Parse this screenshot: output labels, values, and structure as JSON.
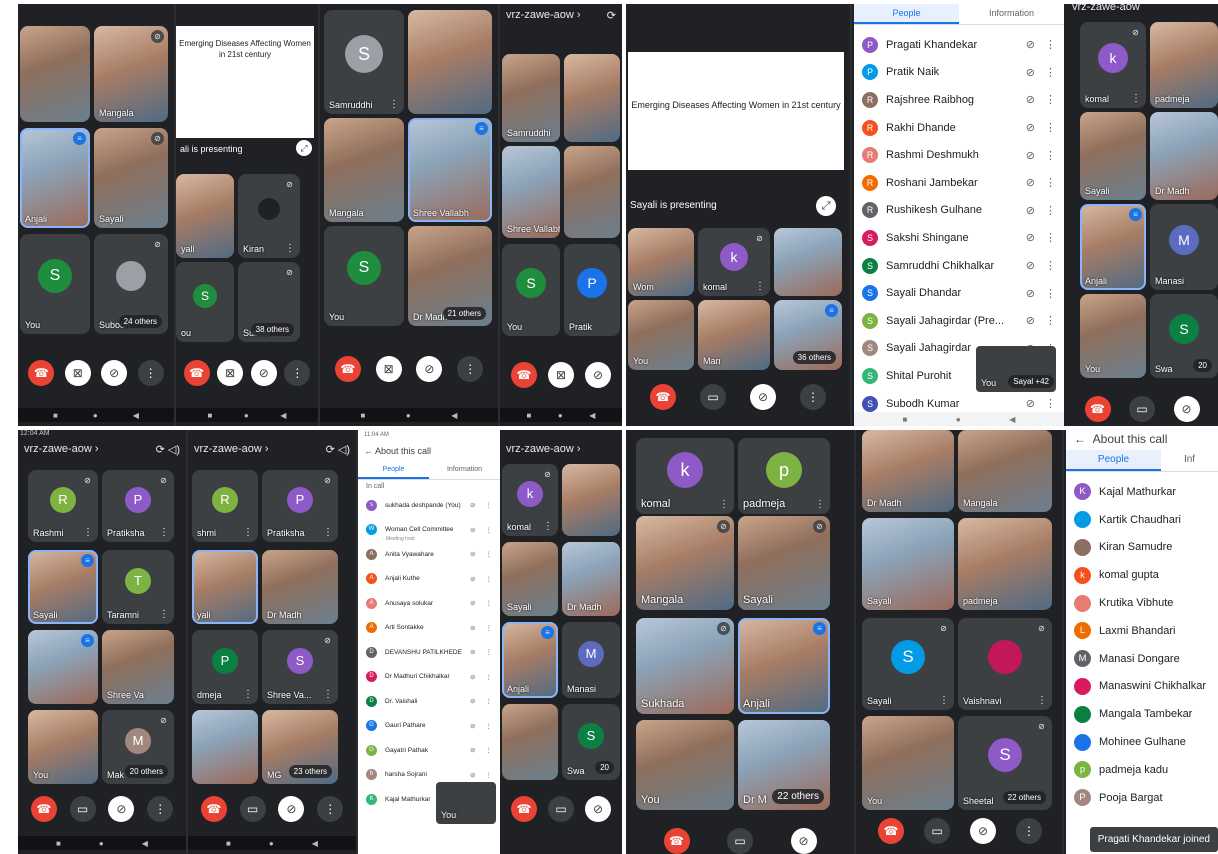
{
  "colors": {
    "end_call": "#ea4335",
    "accent": "#1a73e8",
    "tile_bg": "#3c4043"
  },
  "q1": {
    "s1": {
      "t1": "",
      "t2": "Mangala",
      "t3": "Anjali",
      "t4": "Sayali",
      "t5_avatar": "S",
      "t5": "You",
      "t6": "Subodh",
      "others": "24 others"
    },
    "s2": {
      "slide_title": "Emerging Diseases Affecting Women in 21st century",
      "presenting": "ali is presenting",
      "t1": "yali",
      "t2": "Kiran",
      "t3_avatar": "S",
      "t3": "ou",
      "t4": "Subod",
      "others": "38 others"
    },
    "s3": {
      "t1_avatar": "S",
      "t1": "Samruddhi",
      "t2": "",
      "t3": "Mangala",
      "t4": "Shree Vallabh",
      "t5_avatar": "S",
      "t5": "You",
      "t6": "Dr Madh",
      "others": "21 others"
    },
    "s4": {
      "hdr": "vrz-zawe-aow ›",
      "t1": "Samruddhi",
      "t2": "",
      "t3": "Shree Vallabh",
      "t4": "",
      "t5_avatar": "S",
      "t5": "You",
      "t6_avatar": "P",
      "t6": "Pratik"
    }
  },
  "q2": {
    "slide_title": "Emerging Diseases Affecting Women in 21st century",
    "presenting": "Sayali is presenting",
    "t1": "Wom",
    "t2_avatar": "k",
    "t2": "komal",
    "t3": "",
    "t4": "You",
    "t5": "Man",
    "others": "36 others",
    "panel": {
      "tab_people": "People",
      "tab_info": "Information",
      "people": [
        "Pragati Khandekar",
        "Pratik Naik",
        "Rajshree Raibhog",
        "Rakhi Dhande",
        "Rashmi Deshmukh",
        "Roshani Jambekar",
        "Rushikesh Gulhane",
        "Sakshi Shingane",
        "Samruddhi Chikhalkar",
        "Sayali Dhandar",
        "Sayali Jahagirdar (Pre...",
        "Sayali Jahagirdar",
        "Shital Purohit",
        "Subodh Kumar"
      ],
      "initials": [
        "P",
        "P",
        "R",
        "R",
        "R",
        "R",
        "R",
        "S",
        "S",
        "S",
        "S",
        "S",
        "S",
        "S"
      ],
      "pip": "You",
      "pip2": "Sayal +42"
    },
    "right": {
      "hdr": "vrz-zawe-aow",
      "t1_avatar": "k",
      "t1": "komal",
      "t2": "padmeja",
      "t3": "Sayali",
      "t4": "Dr Madh",
      "t5": "Anjali",
      "t6_avatar": "M",
      "t6": "Manasi",
      "t7": "You",
      "t8_avatar": "S",
      "t8": "Swa",
      "others": "20"
    }
  },
  "q3": {
    "s1": {
      "time": "12:04 AM",
      "hdr": "vrz-zawe-aow ›",
      "t1_avatar": "R",
      "t1": "Rashmi",
      "t2_avatar": "P",
      "t2": "Pratiksha",
      "t3": "Sayali",
      "t4_avatar": "T",
      "t4": "Taramni",
      "t5": "",
      "t6": "Shree Va",
      "t7": "You",
      "t8_avatar": "M",
      "t8": "Mak",
      "others": "20 others"
    },
    "s2": {
      "hdr": "vrz-zawe-aow ›",
      "t1_avatar": "R",
      "t1": "shmi",
      "t2_avatar": "P",
      "t2": "Pratiksha",
      "t3": "yali",
      "t4": "Dr Madh",
      "t5_avatar": "P",
      "t5": "dmeja",
      "t6_avatar": "S",
      "t6": "Shree Va...",
      "t7": "",
      "t8": "MG",
      "others": "23 others"
    },
    "panel": {
      "time": "11:04 AM",
      "title": "About this call",
      "tab_people": "People",
      "tab_info": "Information",
      "section": "In call",
      "people": [
        "sukhada deshpande (You)",
        "Woman Cell Committee",
        "Anita Vyawahare",
        "Anjali Kuthe",
        "Anusaya solukar",
        "Arti Sontakke",
        "DEVANSHU PATILKHEDE",
        "Dr Madhuri Chikhalkar",
        "Dr. Vaishali",
        "Gauri Pathare",
        "Gayatri Pathak",
        "harsha Sojrani",
        "Kajal Mathurkar"
      ],
      "sub1": "Meeting host",
      "initials": [
        "s",
        "W",
        "A",
        "A",
        "A",
        "A",
        "D",
        "D",
        "D",
        "G",
        "G",
        "h",
        "K"
      ],
      "pip": "You"
    },
    "s4": {
      "hdr": "vrz-zawe-aow ›",
      "t1_avatar": "k",
      "t1": "komal",
      "t2": "",
      "t3": "Sayali",
      "t4": "Dr Madh",
      "t5": "Anjali",
      "t6_avatar": "M",
      "t6": "Manasi",
      "t7": "",
      "t8_avatar": "S",
      "t8": "Swa",
      "others": "20"
    }
  },
  "q4": {
    "s1": {
      "t1_avatar": "k",
      "t1": "komal",
      "t2_avatar": "p",
      "t2": "padmeja",
      "t3": "Mangala",
      "t4": "Sayali",
      "t5": "Sukhada",
      "t6": "Anjali",
      "t7": "You",
      "t8": "Dr M",
      "others": "22 others"
    },
    "s2": {
      "t1": "Dr Madh",
      "t2": "Mangala",
      "t3": "Sayali",
      "t4": "padmeja",
      "t5_avatar": "S",
      "t5": "Sayali",
      "t6": "Vaishnavi",
      "t7": "You",
      "t8_avatar": "S",
      "t8": "Sheetal",
      "others": "22 others"
    },
    "panel": {
      "title": "About this call",
      "tab_people": "People",
      "tab_info": "Inf",
      "people": [
        "Kajal Mathurkar",
        "Kartik Chaudhari",
        "Kiran Samudre",
        "komal gupta",
        "Krutika Vibhute",
        "Laxmi Bhandari",
        "Manasi Dongare",
        "Manaswini Chikhalkar",
        "Mangala Tambekar",
        "Mohinee Gulhane",
        "padmeja kadu",
        "Pooja Bargat"
      ],
      "initials": [
        "K",
        "",
        "",
        "k",
        "",
        "L",
        "M",
        "",
        "",
        "",
        "p",
        "P"
      ],
      "toast": "Pragati Khandekar joined"
    }
  }
}
